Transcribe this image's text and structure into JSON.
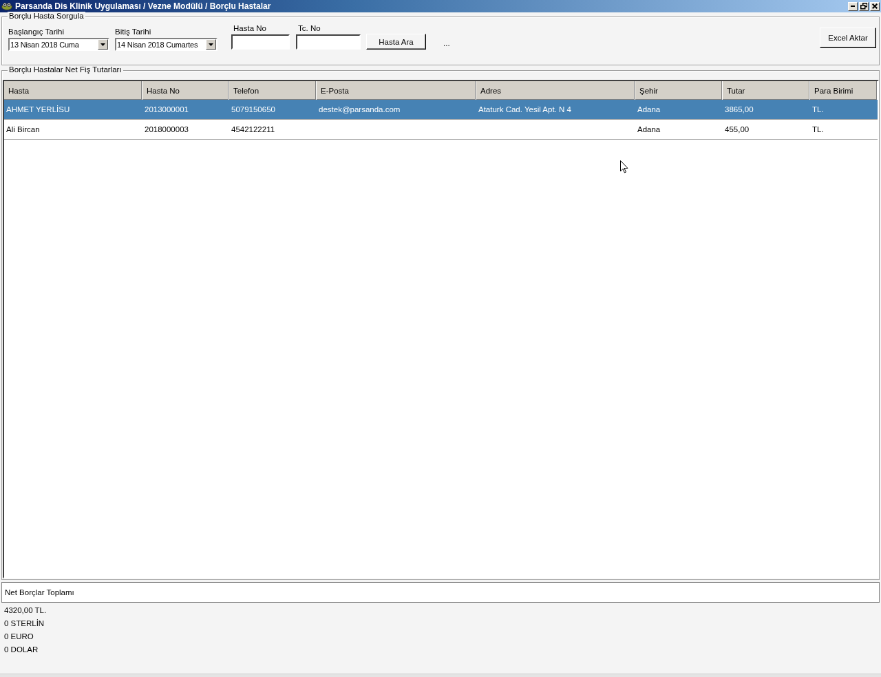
{
  "window": {
    "title": "Parsanda Dis Klinik Uygulaması / Vezne Modülü / Borçlu Hastalar"
  },
  "query": {
    "legend": "Borçlu Hasta Sorgula",
    "fields": [
      {
        "kind": "date",
        "label": "Başlangıç Tarihi",
        "value": "13  Nisan   2018     Cuma"
      },
      {
        "kind": "date",
        "label": "Bitiş Tarihi",
        "value": "14  Nisan   2018 Cumartes"
      },
      {
        "kind": "text",
        "label": "Hasta No"
      },
      {
        "kind": "text",
        "label": "Tc. No"
      }
    ],
    "search_button": "Hasta Ara",
    "ellipsis": "...",
    "export_button": "Excel Aktar"
  },
  "grid": {
    "legend": "Borçlu Hastalar Net Fiş Tutarları",
    "columns": [
      "Hasta",
      "Hasta No",
      "Telefon",
      "E-Posta",
      "Adres",
      "Şehir",
      "Tutar",
      "Para Birimi"
    ],
    "rows": [
      {
        "selected": true,
        "cells": [
          "AHMET YERLİSU",
          "2013000001",
          "5079150650",
          "destek@parsanda.com",
          "Ataturk Cad. Yesil Apt. N 4",
          "Adana",
          "3865,00",
          "TL."
        ]
      },
      {
        "selected": false,
        "cells": [
          "Ali Bircan",
          "2018000003",
          "4542122211",
          "",
          "",
          "Adana",
          "455,00",
          "TL."
        ]
      }
    ]
  },
  "totals": {
    "heading": "Net Borçlar Toplamı",
    "lines": [
      "4320,00 TL.",
      "0 STERLİN",
      "0 EURO",
      "0 DOLAR"
    ]
  }
}
